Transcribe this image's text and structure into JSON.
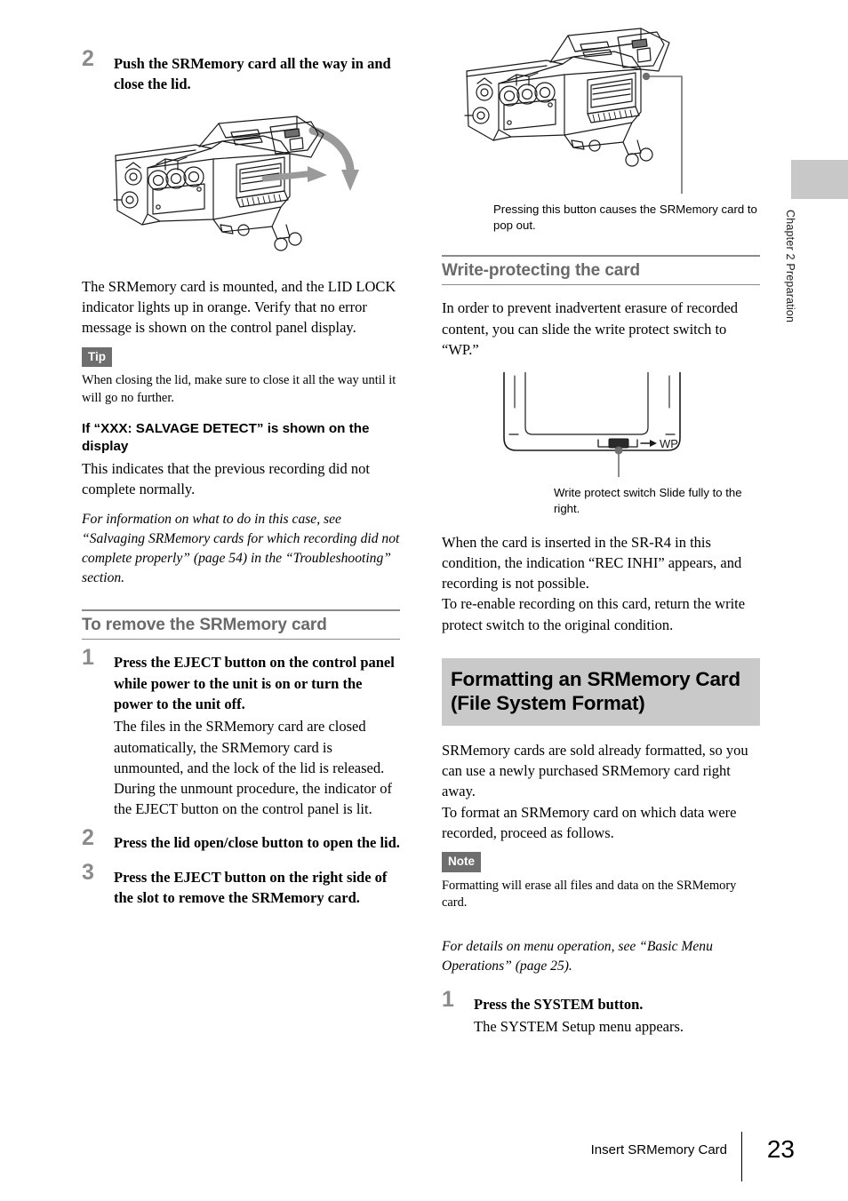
{
  "page": {
    "number": "23",
    "footer_label": "Insert SRMemory Card",
    "chapter_tab": "Chapter 2  Preparation"
  },
  "left_column": {
    "step2": {
      "number": "2",
      "title": "Push the SRMemory card all the way in and close the lid.",
      "illustration_name": "recorder-lid-closing-diagram",
      "body": "The SRMemory card is mounted, and the LID LOCK indicator lights up in orange. Verify that no error message is shown on the control panel display."
    },
    "tip": {
      "badge": "Tip",
      "text": "When closing the lid, make sure to close it all the way until it will go no further."
    },
    "salvage": {
      "heading": "If “XXX: SALVAGE DETECT” is shown on the display",
      "body": "This indicates that the previous recording did not complete normally.",
      "xref": "For information on what to do in this case, see “Salvaging SRMemory cards for which recording did not complete properly” (page 54) in the “Troubleshooting” section."
    },
    "remove_section": {
      "heading": "To remove the SRMemory card",
      "steps": [
        {
          "number": "1",
          "title": "Press the EJECT button on the control panel while power to the unit is on or turn the power to the unit off.",
          "body": "The files in the SRMemory card are closed automatically, the SRMemory card is unmounted, and the lock of the lid is released.\nDuring the unmount procedure, the indicator of the EJECT button on the control panel is lit."
        },
        {
          "number": "2",
          "title": "Press the lid open/close button to open the lid.",
          "body": ""
        },
        {
          "number": "3",
          "title": "Press the EJECT button on the right side of the slot to remove the SRMemory card.",
          "body": ""
        }
      ]
    }
  },
  "right_column": {
    "eject_illustration": {
      "illustration_name": "recorder-eject-button-callout-diagram",
      "caption": "Pressing this button causes the SRMemory card to pop out."
    },
    "write_protect": {
      "heading": "Write-protecting the card",
      "intro": "In order to prevent inadvertent erasure of recorded content, you can slide the write protect switch to “WP.”",
      "card_diagram": {
        "illustration_name": "srmemory-card-write-protect-switch-diagram",
        "switch_label": "WP"
      },
      "diagram_caption": "Write protect switch Slide fully to the right.",
      "body": "When the card is inserted in the SR-R4 in this condition, the indication “REC INHI” appears, and recording is not possible.\nTo re-enable recording on this card, return the write protect switch to the original condition."
    },
    "formatting": {
      "heading_line1": "Formatting an SRMemory Card",
      "heading_line2": "(File System Format)",
      "body": "SRMemory cards are sold already formatted, so you can use a newly purchased SRMemory card right away.\nTo format an SRMemory card on which data were recorded, proceed as follows.",
      "note": {
        "badge": "Note",
        "text": "Formatting will erase all files and data on the SRMemory card."
      },
      "xref": "For details on menu operation, see “Basic Menu Operations” (page 25).",
      "step1": {
        "number": "1",
        "title": "Press the SYSTEM button.",
        "body": "The SYSTEM Setup menu appears."
      }
    }
  },
  "colors": {
    "badge_bg": "#6e6e6e",
    "subhead_gray": "#6a6a6a",
    "majorhead_bg": "#c9c9c9",
    "step_number_gray": "#8b8b8b",
    "tab_gray": "#c8c8c8"
  }
}
